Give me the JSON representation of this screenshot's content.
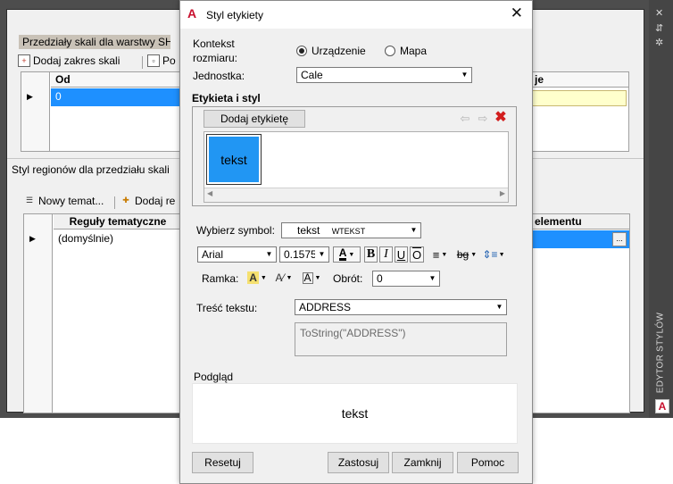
{
  "background": {
    "scale_panel_title": "Przedziały skali dla warstwy SHP_",
    "add_scale_range": "Dodaj zakres skali",
    "po_button": "Po",
    "scale_grid": {
      "col_from": "Od",
      "row_value": "0",
      "col_partial": "je"
    },
    "region_panel_title": "Styl regionów dla przedziału skali",
    "new_theme": "Nowy temat...",
    "add_re": "Dodaj re",
    "theme_grid": {
      "col_rules": "Reguły tematyczne",
      "row_default": "(domyślnie)",
      "col_element": "elementu",
      "ellipsis": "..."
    },
    "side_label": "EDYTOR STYLÓW",
    "icons": [
      "close-icon",
      "pin-icon",
      "gear-icon"
    ]
  },
  "dialog": {
    "title": "Styl etykiety",
    "size_context_label_1": "Kontekst",
    "size_context_label_2": "rozmiaru:",
    "radio_device": "Urządzenie",
    "radio_map": "Mapa",
    "unit_label": "Jednostka:",
    "unit_value": "Cale",
    "label_and_style": "Etykieta i styl",
    "add_label": "Dodaj etykietę",
    "label_sample": "tekst",
    "choose_symbol_label": "Wybierz symbol:",
    "symbol_value": "tekst",
    "symbol_name": "WTEKST",
    "font": "Arial",
    "font_size": "0.1575",
    "bold": "B",
    "italic": "I",
    "underline": "U",
    "overline": "O",
    "bg_label": "bg",
    "frame_label": "Ramka:",
    "rotation_label": "Obrót:",
    "rotation_value": "0",
    "text_content_label": "Treść tekstu:",
    "text_content_value": "ADDRESS",
    "expression": "ToString(\"ADDRESS\")",
    "preview_label": "Podgląd",
    "preview_text": "tekst",
    "buttons": {
      "reset": "Resetuj",
      "apply": "Zastosuj",
      "close": "Zamknij",
      "help": "Pomoc"
    }
  },
  "colors": {
    "accent_blue": "#1e90ff",
    "label_fill": "#2196f3",
    "delete_red": "#d21e1e",
    "logo_red": "#c8102e"
  }
}
